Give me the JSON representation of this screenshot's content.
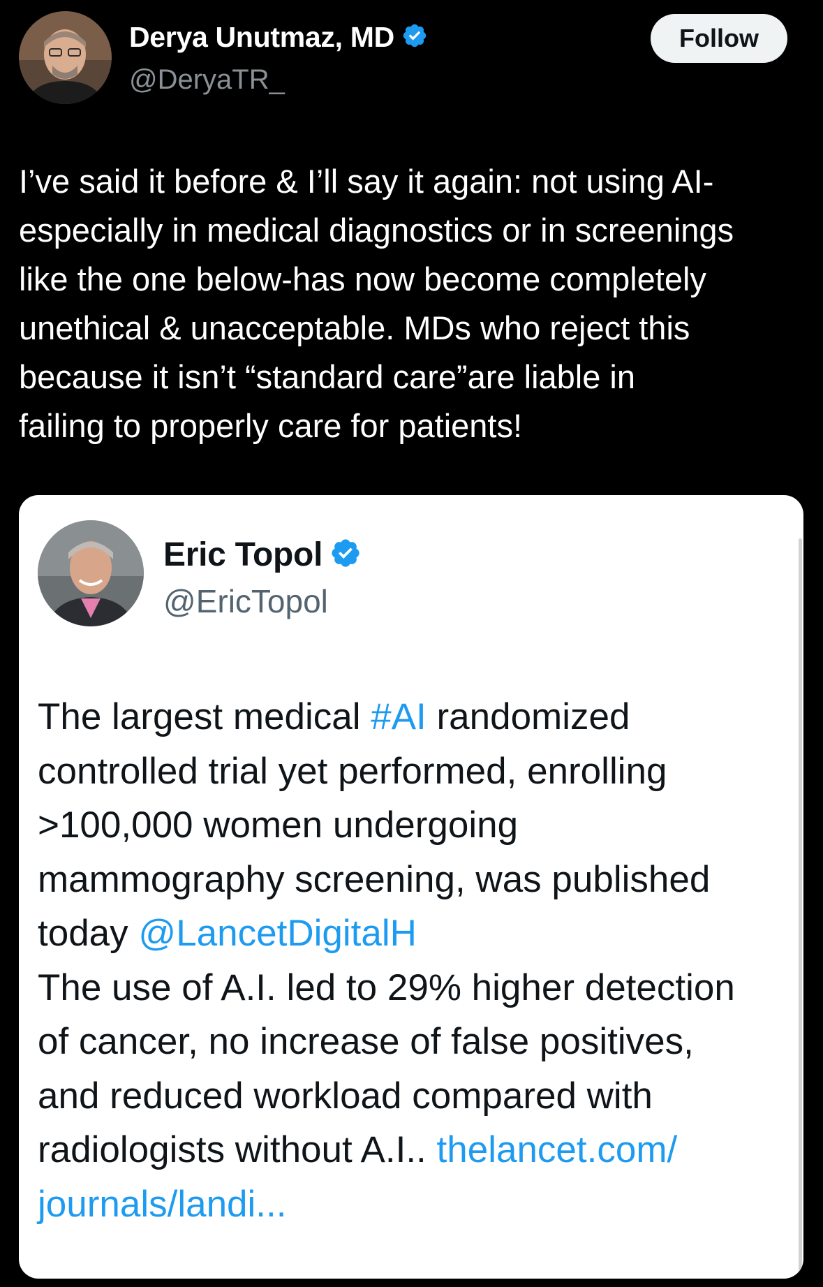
{
  "outer_post": {
    "author_name": "Derya Unutmaz, MD",
    "handle": "@DeryaTR_",
    "verified_icon": "verified-badge-icon",
    "follow_label": "Follow",
    "text_lines": [
      "I’ve said it before & I’ll say it again: not using AI-",
      "especially in medical diagnostics or in screenings",
      "like the one below-has now become completely",
      "unethical & unacceptable. MDs who reject this",
      "because it isn’t “standard care”are liable in",
      "failing to properly care for patients!"
    ]
  },
  "quoted_post": {
    "author_name": "Eric Topol",
    "handle": "@EricTopol",
    "verified_icon": "verified-badge-icon",
    "text": {
      "line1_before": "The largest medical ",
      "line1_hashtag": "#AI",
      "line1_after": " randomized",
      "line2": "controlled trial yet performed, enrolling",
      "line3": ">100,000 women undergoing",
      "line4": "mammography screening, was published",
      "line5_before": "today ",
      "line5_mention": "@LancetDigitalH",
      "line6": "The use of A.I. led to 29% higher detection",
      "line7": "of cancer, no increase of false positives,",
      "line8": "and reduced workload compared with",
      "line9_before": "radiologists without A.I.. ",
      "line9_link": "thelancet.com/",
      "line10_link": "journals/landi..."
    }
  },
  "colors": {
    "background": "#000000",
    "link": "#1d9bf0",
    "verified": "#1d9bf0",
    "card_background": "#ffffff"
  }
}
